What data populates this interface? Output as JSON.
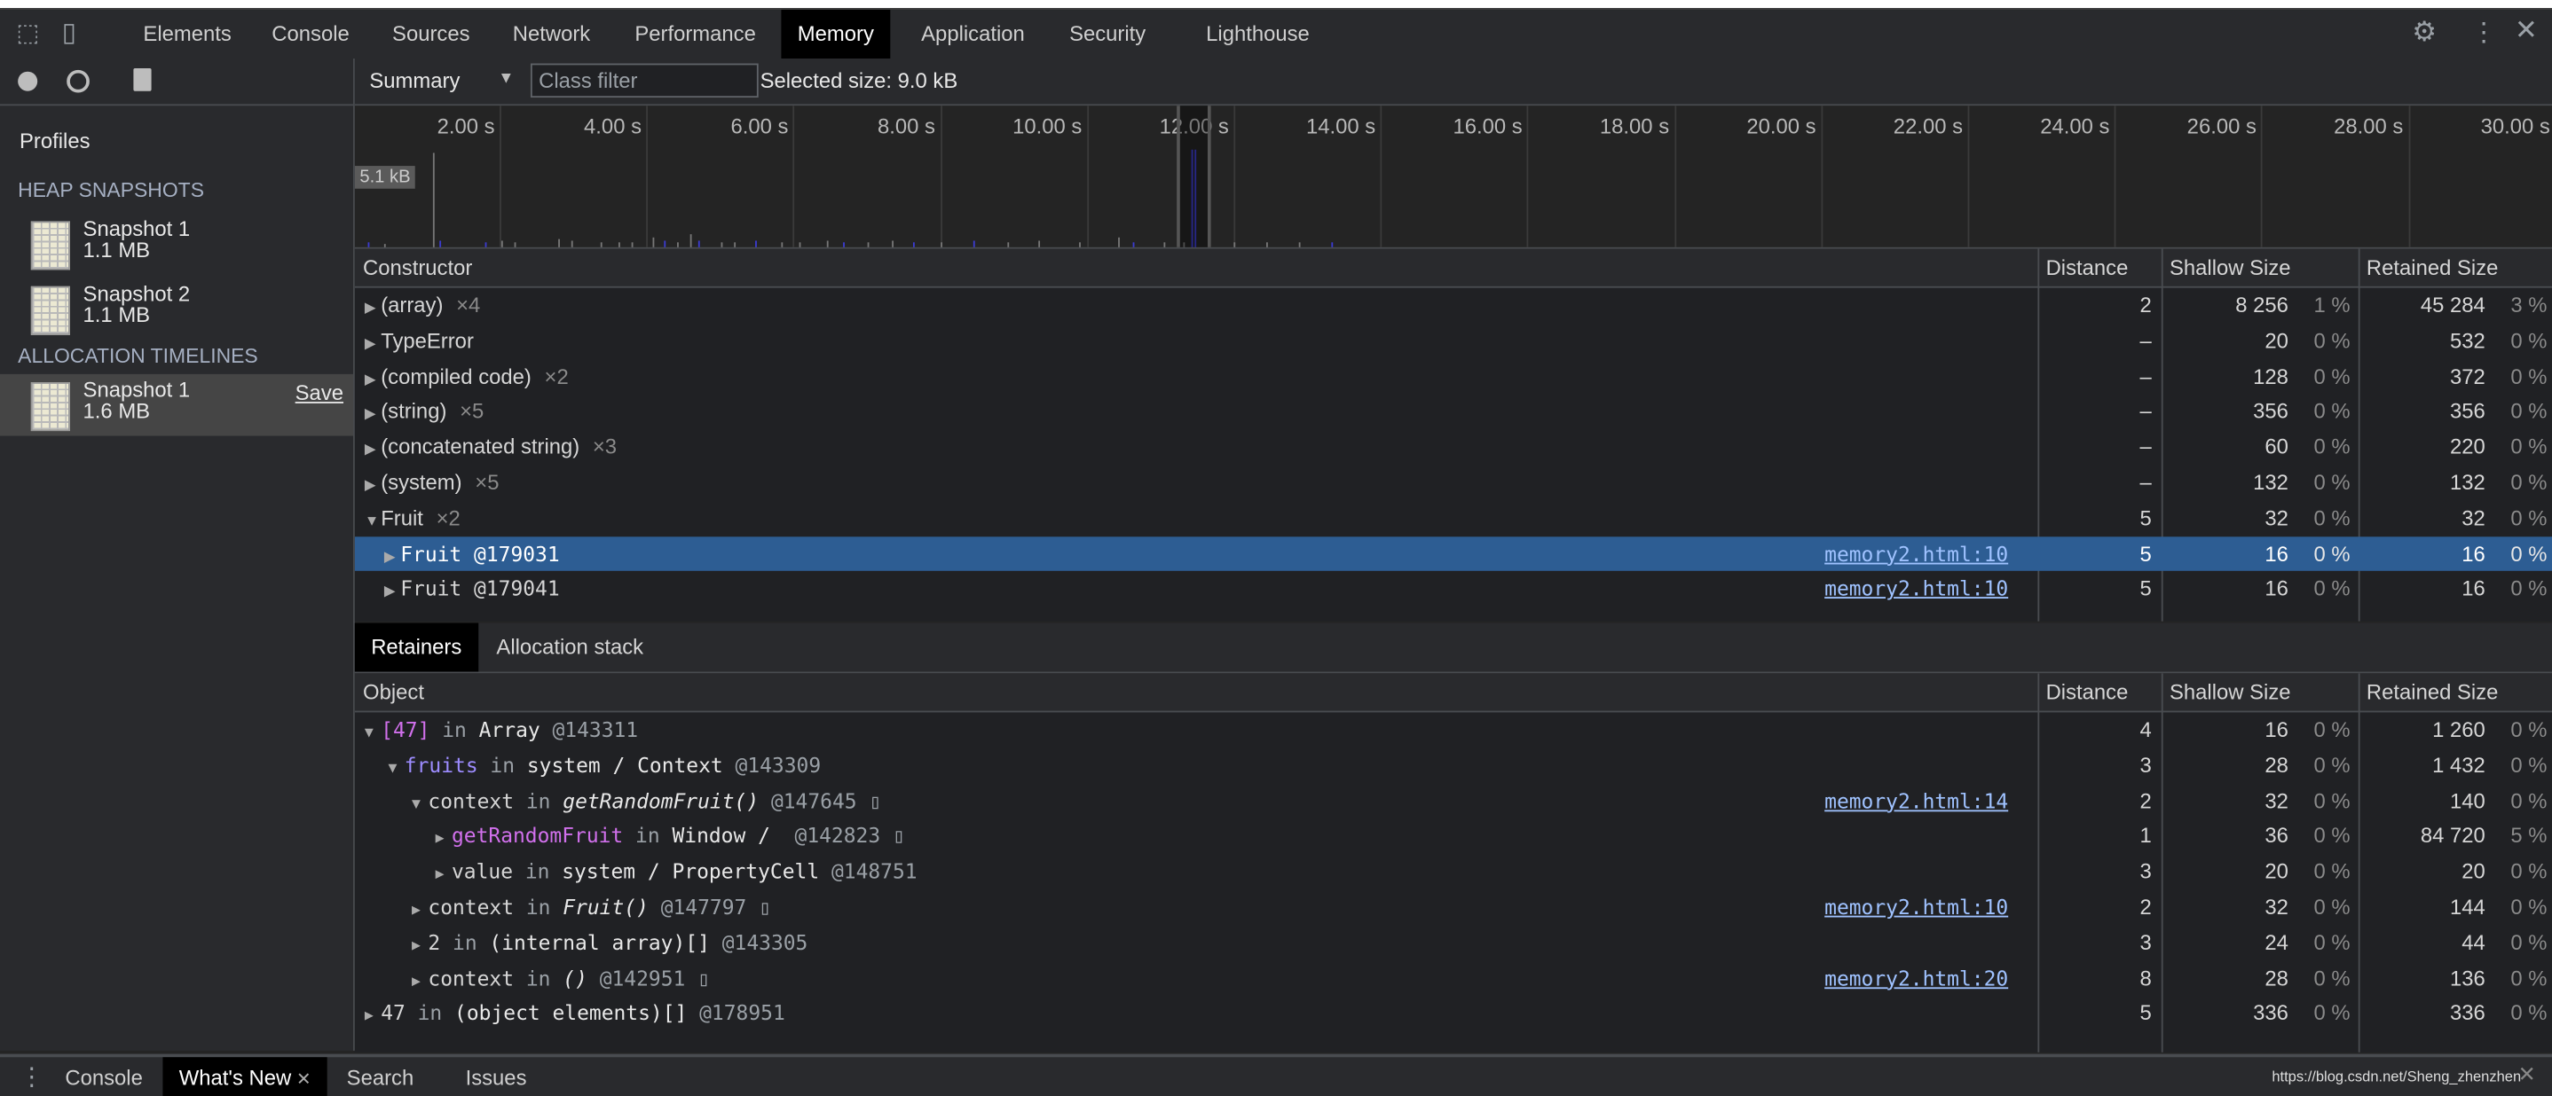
{
  "topbar": {
    "tabs": [
      "Elements",
      "Console",
      "Sources",
      "Network",
      "Performance",
      "Memory",
      "Application",
      "Security",
      "Lighthouse"
    ],
    "active_tab": "Memory",
    "icons": [
      "inspect-element-icon",
      "device-toolbar-icon",
      "gear-icon",
      "more-vertical-icon",
      "close-icon"
    ]
  },
  "sidebar": {
    "title": "Profiles",
    "heap_header": "HEAP SNAPSHOTS",
    "heap_snapshots": [
      {
        "name": "Snapshot 1",
        "size": "1.1 MB"
      },
      {
        "name": "Snapshot 2",
        "size": "1.1 MB"
      }
    ],
    "alloc_header": "ALLOCATION TIMELINES",
    "alloc_timelines": [
      {
        "name": "Snapshot 1",
        "size": "1.6 MB",
        "save": "Save",
        "selected": true
      }
    ]
  },
  "toolbar": {
    "view": "Summary",
    "class_filter_placeholder": "Class filter",
    "selected_size": "Selected size: 9.0 kB"
  },
  "timeline": {
    "ticks": [
      "2.00 s",
      "4.00 s",
      "6.00 s",
      "8.00 s",
      "10.00 s",
      "12.00 s",
      "14.00 s",
      "16.00 s",
      "18.00 s",
      "20.00 s",
      "22.00 s",
      "24.00 s",
      "26.00 s",
      "28.00 s",
      "30.00 s"
    ],
    "max_label": "5.1 kB"
  },
  "constructors": {
    "columns": [
      "Constructor",
      "Distance",
      "Shallow Size",
      "Retained Size"
    ],
    "rows": [
      {
        "name": "(array)",
        "count": "×4",
        "expanded": false,
        "level": 0,
        "distance": "2",
        "shallow": "8 256",
        "shallow_pct": "1 %",
        "retained": "45 284",
        "retained_pct": "3 %"
      },
      {
        "name": "TypeError",
        "count": "",
        "expanded": false,
        "level": 0,
        "distance": "–",
        "shallow": "20",
        "shallow_pct": "0 %",
        "retained": "532",
        "retained_pct": "0 %"
      },
      {
        "name": "(compiled code)",
        "count": "×2",
        "expanded": false,
        "level": 0,
        "distance": "–",
        "shallow": "128",
        "shallow_pct": "0 %",
        "retained": "372",
        "retained_pct": "0 %"
      },
      {
        "name": "(string)",
        "count": "×5",
        "expanded": false,
        "level": 0,
        "distance": "–",
        "shallow": "356",
        "shallow_pct": "0 %",
        "retained": "356",
        "retained_pct": "0 %"
      },
      {
        "name": "(concatenated string)",
        "count": "×3",
        "expanded": false,
        "level": 0,
        "distance": "–",
        "shallow": "60",
        "shallow_pct": "0 %",
        "retained": "220",
        "retained_pct": "0 %"
      },
      {
        "name": "(system)",
        "count": "×5",
        "expanded": false,
        "level": 0,
        "distance": "–",
        "shallow": "132",
        "shallow_pct": "0 %",
        "retained": "132",
        "retained_pct": "0 %"
      },
      {
        "name": "Fruit",
        "count": "×2",
        "expanded": true,
        "level": 0,
        "distance": "5",
        "shallow": "32",
        "shallow_pct": "0 %",
        "retained": "32",
        "retained_pct": "0 %"
      },
      {
        "name": "Fruit @179031",
        "count": "",
        "expanded": false,
        "level": 1,
        "mono": true,
        "selected": true,
        "link": "memory2.html:10",
        "distance": "5",
        "shallow": "16",
        "shallow_pct": "0 %",
        "retained": "16",
        "retained_pct": "0 %"
      },
      {
        "name": "Fruit @179041",
        "count": "",
        "expanded": false,
        "level": 1,
        "mono": true,
        "link": "memory2.html:10",
        "distance": "5",
        "shallow": "16",
        "shallow_pct": "0 %",
        "retained": "16",
        "retained_pct": "0 %"
      }
    ]
  },
  "bottom_tabs": [
    "Retainers",
    "Allocation stack"
  ],
  "bottom_active": "Retainers",
  "retainers": {
    "columns": [
      "Object",
      "Distance",
      "Shallow Size",
      "Retained Size"
    ],
    "rows": [
      {
        "level": 0,
        "expanded": true,
        "parts": [
          [
            "[47]",
            "purple"
          ],
          [
            " in ",
            "dim"
          ],
          [
            "Array ",
            "bright"
          ],
          [
            "@143311",
            "dim"
          ]
        ],
        "distance": "4",
        "shallow": "16",
        "shallow_pct": "0 %",
        "retained": "1 260",
        "retained_pct": "0 %"
      },
      {
        "level": 1,
        "expanded": true,
        "parts": [
          [
            "fruits",
            "violet"
          ],
          [
            " in ",
            "dim"
          ],
          [
            "system / Context ",
            "bright"
          ],
          [
            "@143309",
            "dim"
          ]
        ],
        "distance": "3",
        "shallow": "28",
        "shallow_pct": "0 %",
        "retained": "1 432",
        "retained_pct": "0 %"
      },
      {
        "level": 2,
        "expanded": true,
        "parts": [
          [
            "context",
            ""
          ],
          [
            " in ",
            "dim"
          ],
          [
            "getRandomFruit()",
            "it"
          ],
          [
            " @147645 ▯",
            "dim"
          ]
        ],
        "link": "memory2.html:14",
        "distance": "2",
        "shallow": "32",
        "shallow_pct": "0 %",
        "retained": "140",
        "retained_pct": "0 %"
      },
      {
        "level": 3,
        "expanded": false,
        "parts": [
          [
            "getRandomFruit",
            "purple"
          ],
          [
            " in ",
            "dim"
          ],
          [
            "Window /  ",
            "bright"
          ],
          [
            "@142823 ▯",
            "dim"
          ]
        ],
        "distance": "1",
        "shallow": "36",
        "shallow_pct": "0 %",
        "retained": "84 720",
        "retained_pct": "5 %"
      },
      {
        "level": 3,
        "expanded": false,
        "parts": [
          [
            "value",
            ""
          ],
          [
            " in ",
            "dim"
          ],
          [
            "system / PropertyCell ",
            "bright"
          ],
          [
            "@148751",
            "dim"
          ]
        ],
        "distance": "3",
        "shallow": "20",
        "shallow_pct": "0 %",
        "retained": "20",
        "retained_pct": "0 %"
      },
      {
        "level": 2,
        "expanded": false,
        "parts": [
          [
            "context",
            ""
          ],
          [
            " in ",
            "dim"
          ],
          [
            "Fruit()",
            "it"
          ],
          [
            " @147797 ▯",
            "dim"
          ]
        ],
        "link": "memory2.html:10",
        "distance": "2",
        "shallow": "32",
        "shallow_pct": "0 %",
        "retained": "144",
        "retained_pct": "0 %"
      },
      {
        "level": 2,
        "expanded": false,
        "parts": [
          [
            "2",
            ""
          ],
          [
            " in ",
            "dim"
          ],
          [
            "(internal array)[] ",
            "bright"
          ],
          [
            "@143305",
            "dim"
          ]
        ],
        "distance": "3",
        "shallow": "24",
        "shallow_pct": "0 %",
        "retained": "44",
        "retained_pct": "0 %"
      },
      {
        "level": 2,
        "expanded": false,
        "parts": [
          [
            "context",
            ""
          ],
          [
            " in ",
            "dim"
          ],
          [
            "()",
            "it"
          ],
          [
            " @142951 ▯",
            "dim"
          ]
        ],
        "link": "memory2.html:20",
        "distance": "8",
        "shallow": "28",
        "shallow_pct": "0 %",
        "retained": "136",
        "retained_pct": "0 %"
      },
      {
        "level": 0,
        "expanded": false,
        "parts": [
          [
            "47",
            ""
          ],
          [
            " in ",
            "dim"
          ],
          [
            "(object elements)[] ",
            "bright"
          ],
          [
            "@178951",
            "dim"
          ]
        ],
        "distance": "5",
        "shallow": "336",
        "shallow_pct": "0 %",
        "retained": "336",
        "retained_pct": "0 %"
      }
    ]
  },
  "drawer": {
    "tabs": [
      "Console",
      "What's New",
      "Search",
      "Issues"
    ],
    "active": "What's New",
    "watermark": "https://blog.csdn.net/Sheng_zhenzhen"
  }
}
